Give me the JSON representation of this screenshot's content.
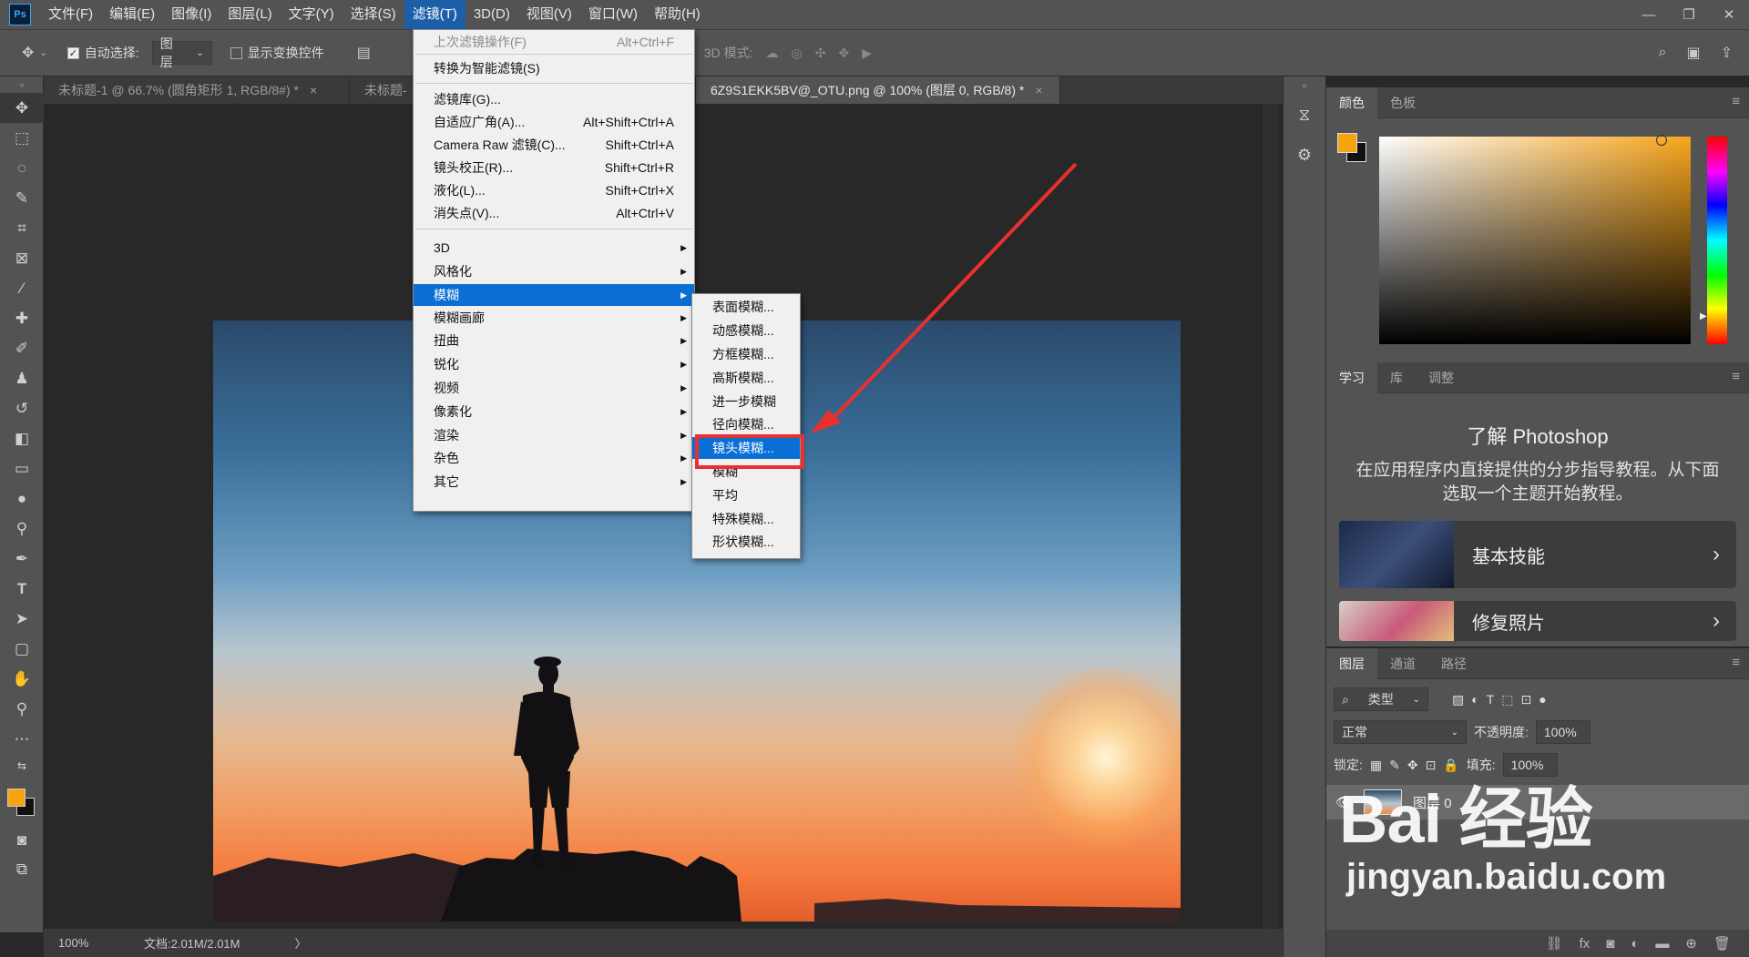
{
  "app": {
    "logo": "Ps"
  },
  "menubar": [
    "文件(F)",
    "编辑(E)",
    "图像(I)",
    "图层(L)",
    "文字(Y)",
    "选择(S)",
    "滤镜(T)",
    "3D(D)",
    "视图(V)",
    "窗口(W)",
    "帮助(H)"
  ],
  "active_menu": "滤镜(T)",
  "window_controls": [
    "—",
    "❐",
    "✕"
  ],
  "options": {
    "auto_select_label": "自动选择:",
    "auto_select_value": "图层",
    "show_transform_label": "显示变换控件",
    "mode_3d_label": "3D 模式:"
  },
  "tabs": [
    {
      "label": "未标题-1 @ 66.7% (圆角矩形 1, RGB/8#) *",
      "active": false
    },
    {
      "label": "未标题-",
      "active": false
    },
    {
      "label": "6Z9S1EKK5BV@_OTU.png @ 100% (图层 0, RGB/8) *",
      "active": true
    }
  ],
  "tab_close": "×",
  "status": {
    "zoom": "100%",
    "doc": "文档:2.01M/2.01M",
    "arrow": "〉"
  },
  "filter_menu": {
    "items": [
      {
        "label": "上次滤镜操作(F)",
        "shortcut": "Alt+Ctrl+F",
        "disabled": true
      },
      {
        "label": "转换为智能滤镜(S)",
        "shortcut": ""
      },
      {
        "label": "滤镜库(G)...",
        "shortcut": ""
      },
      {
        "label": "自适应广角(A)...",
        "shortcut": "Alt+Shift+Ctrl+A"
      },
      {
        "label": "Camera Raw 滤镜(C)...",
        "shortcut": "Shift+Ctrl+A"
      },
      {
        "label": "镜头校正(R)...",
        "shortcut": "Shift+Ctrl+R"
      },
      {
        "label": "液化(L)...",
        "shortcut": "Shift+Ctrl+X"
      },
      {
        "label": "消失点(V)...",
        "shortcut": "Alt+Ctrl+V"
      },
      {
        "label": "3D",
        "submenu": true
      },
      {
        "label": "风格化",
        "submenu": true
      },
      {
        "label": "模糊",
        "submenu": true,
        "highlighted": true
      },
      {
        "label": "模糊画廊",
        "submenu": true
      },
      {
        "label": "扭曲",
        "submenu": true
      },
      {
        "label": "锐化",
        "submenu": true
      },
      {
        "label": "视频",
        "submenu": true
      },
      {
        "label": "像素化",
        "submenu": true
      },
      {
        "label": "渲染",
        "submenu": true
      },
      {
        "label": "杂色",
        "submenu": true
      },
      {
        "label": "其它",
        "submenu": true
      }
    ]
  },
  "blur_submenu": [
    "表面模糊...",
    "动感模糊...",
    "方框模糊...",
    "高斯模糊...",
    "进一步模糊",
    "径向模糊...",
    "镜头模糊...",
    "模糊",
    "平均",
    "特殊模糊...",
    "形状模糊..."
  ],
  "blur_selected": "镜头模糊...",
  "color_panel": {
    "tabs": [
      "颜色",
      "色板"
    ],
    "foreground": "#f6a312",
    "background": "#111111"
  },
  "learn_panel": {
    "tabs": [
      "学习",
      "库",
      "调整"
    ],
    "title": "了解 Photoshop",
    "description": "在应用程序内直接提供的分步指导教程。从下面选取一个主题开始教程。",
    "cards": [
      "基本技能",
      "修复照片"
    ]
  },
  "layers_panel": {
    "tabs": [
      "图层",
      "通道",
      "路径"
    ],
    "filter_type": "类型",
    "blend_mode": "正常",
    "opacity_label": "不透明度:",
    "opacity": "100%",
    "lock_label": "锁定:",
    "fill_label": "填充:",
    "fill": "100%",
    "layers": [
      {
        "name": "图层 0",
        "visible": true
      }
    ]
  },
  "watermark": {
    "logo": "Bai 经验",
    "url": "jingyan.baidu.com"
  },
  "colors": {
    "accent": "#0a6fd4",
    "highlight_box": "#e8302f",
    "arrow": "#e8302f"
  }
}
